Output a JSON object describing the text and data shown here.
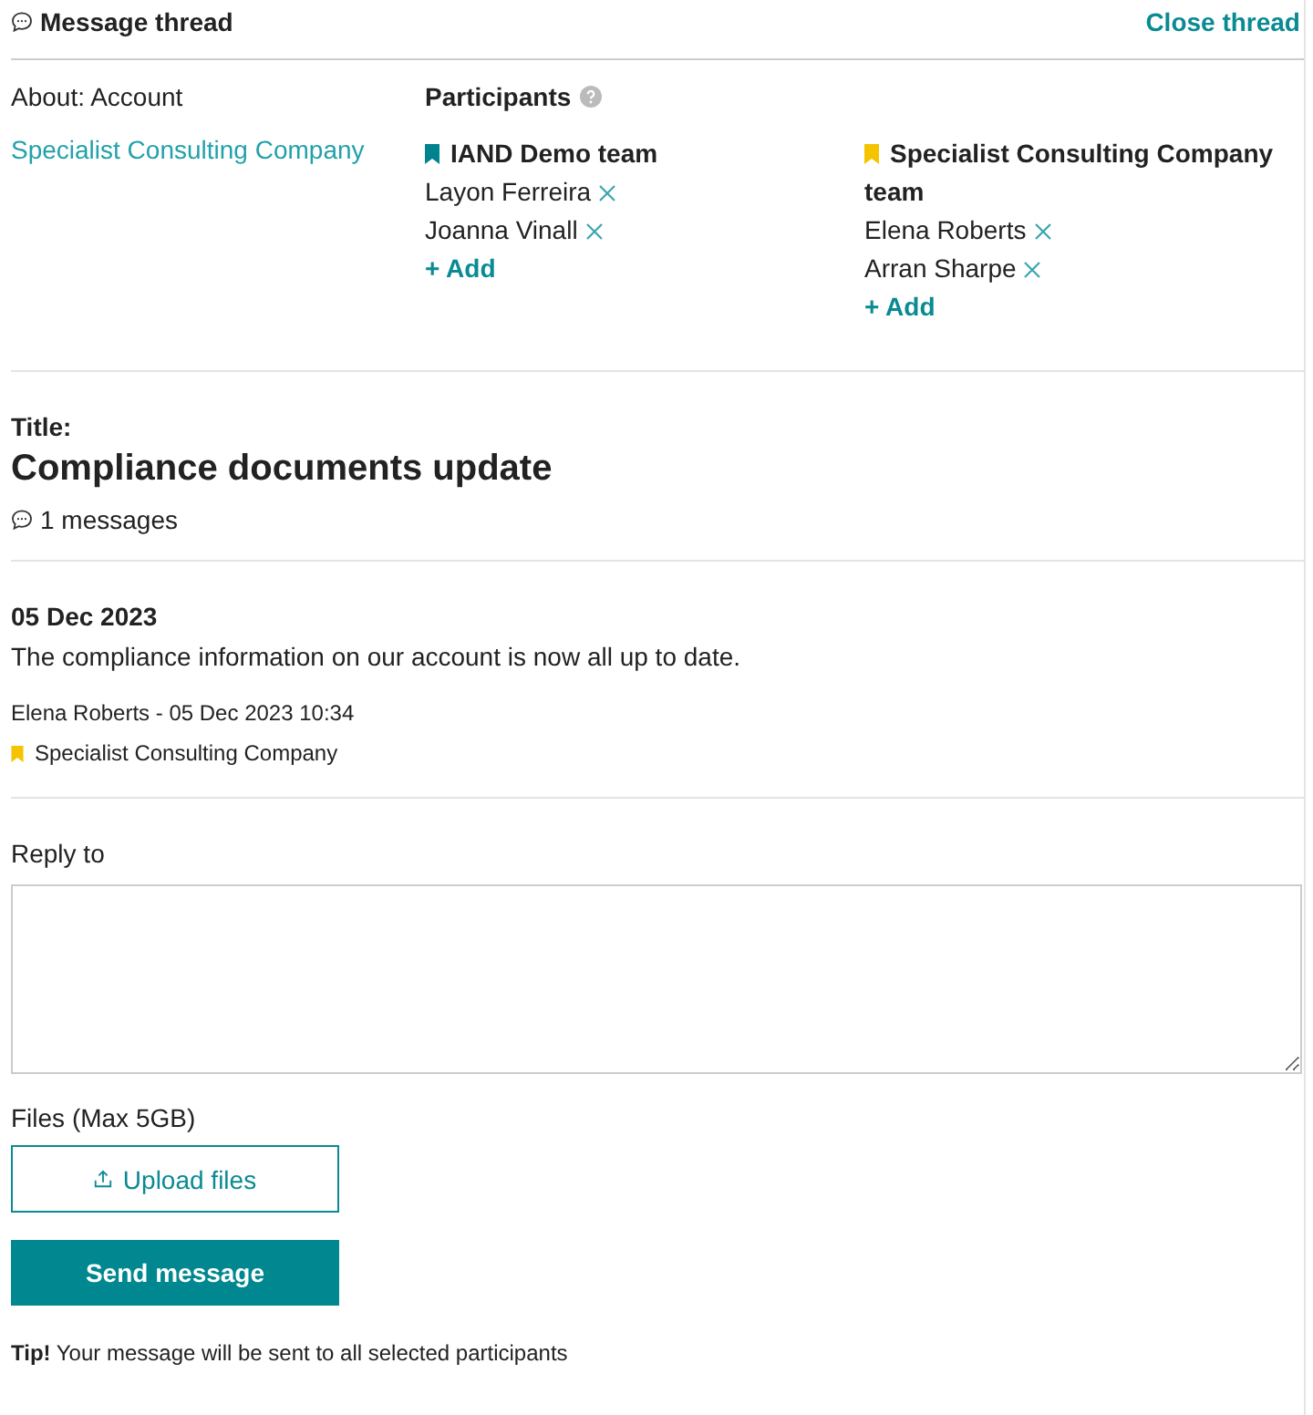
{
  "header": {
    "title": "Message thread",
    "close_link": "Close thread"
  },
  "about": {
    "label": "About: Account",
    "link": "Specialist Consulting Company"
  },
  "participants": {
    "heading": "Participants",
    "teams": [
      {
        "name": "IAND Demo team",
        "color": "#00838f",
        "members": [
          "Layon Ferreira",
          "Joanna Vinall"
        ],
        "add": "+ Add"
      },
      {
        "name": "Specialist Consulting Company team",
        "color": "#f5c400",
        "members": [
          "Elena Roberts",
          "Arran Sharpe"
        ],
        "add": "+ Add"
      }
    ]
  },
  "thread": {
    "title_label": "Title:",
    "title": "Compliance documents update",
    "count": "1 messages"
  },
  "messages": [
    {
      "date": "05 Dec 2023",
      "body": "The compliance information on our account is now all up to date.",
      "meta": "Elena Roberts - 05 Dec 2023 10:34",
      "company": "Specialist Consulting Company",
      "color": "#f5c400"
    }
  ],
  "reply": {
    "label": "Reply to",
    "files_label": "Files (Max 5GB)",
    "upload": "Upload files",
    "send": "Send message",
    "tip": "**Tip!** Your message will be sent to all selected participants"
  }
}
